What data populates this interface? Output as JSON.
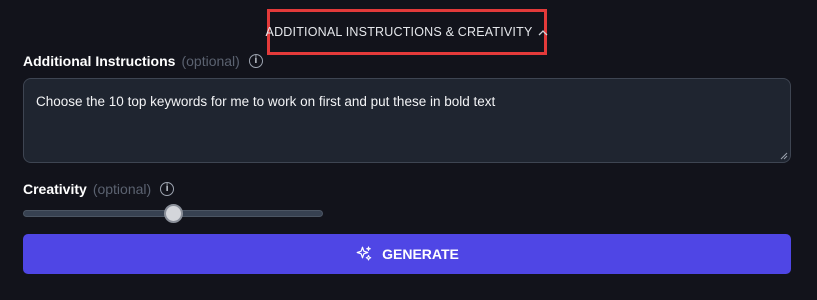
{
  "toggle": {
    "label": "ADDITIONAL INSTRUCTIONS & CREATIVITY",
    "icon": "chevron-up-icon",
    "highlight_color": "#e33a3a"
  },
  "instructions": {
    "label": "Additional Instructions",
    "optional": "(optional)",
    "info_icon": "info-icon",
    "value": "Choose the 10 top keywords for me to work on first and put these in bold text"
  },
  "creativity": {
    "label": "Creativity",
    "optional": "(optional)",
    "info_icon": "info-icon",
    "slider_value": 0.5
  },
  "generate": {
    "label": "GENERATE",
    "icon": "sparkles-icon",
    "color": "#4f46e5"
  }
}
